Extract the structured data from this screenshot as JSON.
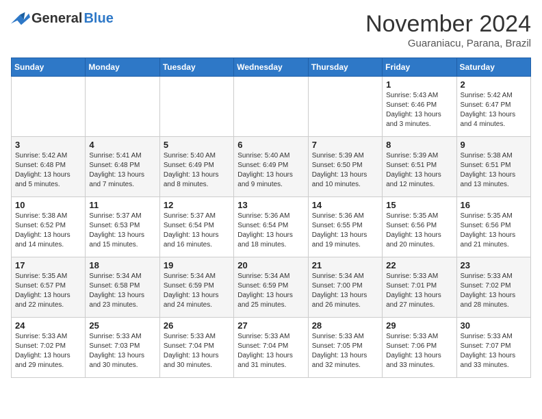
{
  "logo": {
    "general": "General",
    "blue": "Blue"
  },
  "title": "November 2024",
  "subtitle": "Guaraniacu, Parana, Brazil",
  "weekdays": [
    "Sunday",
    "Monday",
    "Tuesday",
    "Wednesday",
    "Thursday",
    "Friday",
    "Saturday"
  ],
  "weeks": [
    [
      {
        "day": "",
        "info": ""
      },
      {
        "day": "",
        "info": ""
      },
      {
        "day": "",
        "info": ""
      },
      {
        "day": "",
        "info": ""
      },
      {
        "day": "",
        "info": ""
      },
      {
        "day": "1",
        "info": "Sunrise: 5:43 AM\nSunset: 6:46 PM\nDaylight: 13 hours and 3 minutes."
      },
      {
        "day": "2",
        "info": "Sunrise: 5:42 AM\nSunset: 6:47 PM\nDaylight: 13 hours and 4 minutes."
      }
    ],
    [
      {
        "day": "3",
        "info": "Sunrise: 5:42 AM\nSunset: 6:48 PM\nDaylight: 13 hours and 5 minutes."
      },
      {
        "day": "4",
        "info": "Sunrise: 5:41 AM\nSunset: 6:48 PM\nDaylight: 13 hours and 7 minutes."
      },
      {
        "day": "5",
        "info": "Sunrise: 5:40 AM\nSunset: 6:49 PM\nDaylight: 13 hours and 8 minutes."
      },
      {
        "day": "6",
        "info": "Sunrise: 5:40 AM\nSunset: 6:49 PM\nDaylight: 13 hours and 9 minutes."
      },
      {
        "day": "7",
        "info": "Sunrise: 5:39 AM\nSunset: 6:50 PM\nDaylight: 13 hours and 10 minutes."
      },
      {
        "day": "8",
        "info": "Sunrise: 5:39 AM\nSunset: 6:51 PM\nDaylight: 13 hours and 12 minutes."
      },
      {
        "day": "9",
        "info": "Sunrise: 5:38 AM\nSunset: 6:51 PM\nDaylight: 13 hours and 13 minutes."
      }
    ],
    [
      {
        "day": "10",
        "info": "Sunrise: 5:38 AM\nSunset: 6:52 PM\nDaylight: 13 hours and 14 minutes."
      },
      {
        "day": "11",
        "info": "Sunrise: 5:37 AM\nSunset: 6:53 PM\nDaylight: 13 hours and 15 minutes."
      },
      {
        "day": "12",
        "info": "Sunrise: 5:37 AM\nSunset: 6:54 PM\nDaylight: 13 hours and 16 minutes."
      },
      {
        "day": "13",
        "info": "Sunrise: 5:36 AM\nSunset: 6:54 PM\nDaylight: 13 hours and 18 minutes."
      },
      {
        "day": "14",
        "info": "Sunrise: 5:36 AM\nSunset: 6:55 PM\nDaylight: 13 hours and 19 minutes."
      },
      {
        "day": "15",
        "info": "Sunrise: 5:35 AM\nSunset: 6:56 PM\nDaylight: 13 hours and 20 minutes."
      },
      {
        "day": "16",
        "info": "Sunrise: 5:35 AM\nSunset: 6:56 PM\nDaylight: 13 hours and 21 minutes."
      }
    ],
    [
      {
        "day": "17",
        "info": "Sunrise: 5:35 AM\nSunset: 6:57 PM\nDaylight: 13 hours and 22 minutes."
      },
      {
        "day": "18",
        "info": "Sunrise: 5:34 AM\nSunset: 6:58 PM\nDaylight: 13 hours and 23 minutes."
      },
      {
        "day": "19",
        "info": "Sunrise: 5:34 AM\nSunset: 6:59 PM\nDaylight: 13 hours and 24 minutes."
      },
      {
        "day": "20",
        "info": "Sunrise: 5:34 AM\nSunset: 6:59 PM\nDaylight: 13 hours and 25 minutes."
      },
      {
        "day": "21",
        "info": "Sunrise: 5:34 AM\nSunset: 7:00 PM\nDaylight: 13 hours and 26 minutes."
      },
      {
        "day": "22",
        "info": "Sunrise: 5:33 AM\nSunset: 7:01 PM\nDaylight: 13 hours and 27 minutes."
      },
      {
        "day": "23",
        "info": "Sunrise: 5:33 AM\nSunset: 7:02 PM\nDaylight: 13 hours and 28 minutes."
      }
    ],
    [
      {
        "day": "24",
        "info": "Sunrise: 5:33 AM\nSunset: 7:02 PM\nDaylight: 13 hours and 29 minutes."
      },
      {
        "day": "25",
        "info": "Sunrise: 5:33 AM\nSunset: 7:03 PM\nDaylight: 13 hours and 30 minutes."
      },
      {
        "day": "26",
        "info": "Sunrise: 5:33 AM\nSunset: 7:04 PM\nDaylight: 13 hours and 30 minutes."
      },
      {
        "day": "27",
        "info": "Sunrise: 5:33 AM\nSunset: 7:04 PM\nDaylight: 13 hours and 31 minutes."
      },
      {
        "day": "28",
        "info": "Sunrise: 5:33 AM\nSunset: 7:05 PM\nDaylight: 13 hours and 32 minutes."
      },
      {
        "day": "29",
        "info": "Sunrise: 5:33 AM\nSunset: 7:06 PM\nDaylight: 13 hours and 33 minutes."
      },
      {
        "day": "30",
        "info": "Sunrise: 5:33 AM\nSunset: 7:07 PM\nDaylight: 13 hours and 33 minutes."
      }
    ]
  ]
}
